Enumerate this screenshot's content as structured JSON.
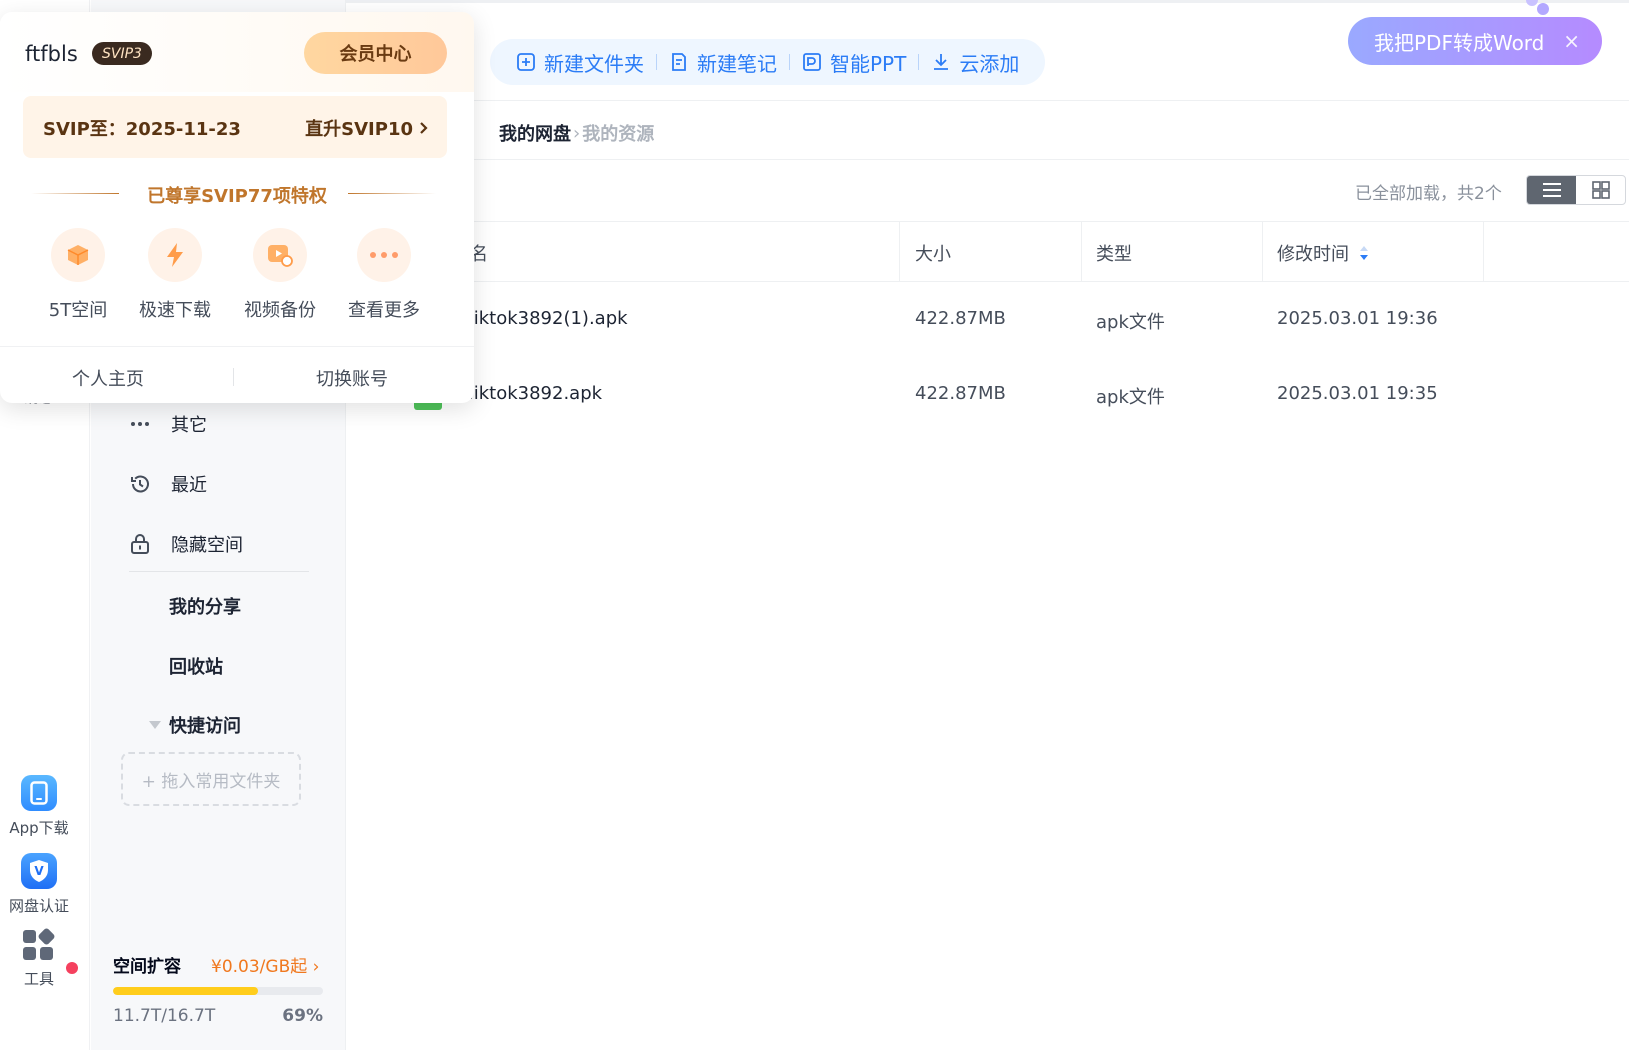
{
  "rail": {
    "message": "消息",
    "app_download": "App下载",
    "cert": "网盘认证",
    "tools": "工具"
  },
  "sidebar": {
    "items": [
      {
        "label": "其它",
        "icon": "more-dots-icon"
      },
      {
        "label": "最近",
        "icon": "history-icon"
      },
      {
        "label": "隐藏空间",
        "icon": "lock-icon"
      }
    ],
    "my_share": "我的分享",
    "recycle": "回收站",
    "quick_access": "快捷访问",
    "drop_hint": "+ 拖入常用文件夹",
    "storage": {
      "title": "空间扩容",
      "price": "¥0.03/GB起",
      "used": "11.7T/16.7T",
      "percent_text": "69%",
      "percent": 69
    }
  },
  "toolbar": {
    "prefix": ")",
    "new_folder": "新建文件夹",
    "new_note": "新建笔记",
    "smart_ppt": "智能PPT",
    "cloud_add": "云添加"
  },
  "promo": {
    "text": "我把PDF转成Word",
    "close": "×"
  },
  "breadcrumb": {
    "root": "我的网盘",
    "sep": "›",
    "current": "我的资源"
  },
  "list": {
    "status": "已全部加载，共2个",
    "headers": {
      "name": "名",
      "size": "大小",
      "type": "类型",
      "modified": "修改时间"
    },
    "rows": [
      {
        "name": ".iktok3892(1).apk",
        "size": "422.87MB",
        "type": "apk文件",
        "modified": "2025.03.01 19:36"
      },
      {
        "name": ".iktok3892.apk",
        "size": "422.87MB",
        "type": "apk文件",
        "modified": "2025.03.01 19:35"
      }
    ]
  },
  "popover": {
    "username": "ftfbls",
    "badge": "SVIP3",
    "vip_center": "会员中心",
    "svip_expire": "SVIP至：2025-11-23",
    "upgrade": "直升SVIP10",
    "privileges_title": "已尊享SVIP77项特权",
    "perks": [
      {
        "label": "5T空间",
        "icon": "cube-icon"
      },
      {
        "label": "极速下载",
        "icon": "lightning-icon"
      },
      {
        "label": "视频备份",
        "icon": "video-backup-icon"
      },
      {
        "label": "查看更多",
        "icon": "more-icon"
      }
    ],
    "profile": "个人主页",
    "switch_account": "切换账号"
  },
  "colors": {
    "accent": "#2b7cf6",
    "storage_fill": "#ffcd1c",
    "price": "#f0781e",
    "gold_text": "#c0762c"
  }
}
